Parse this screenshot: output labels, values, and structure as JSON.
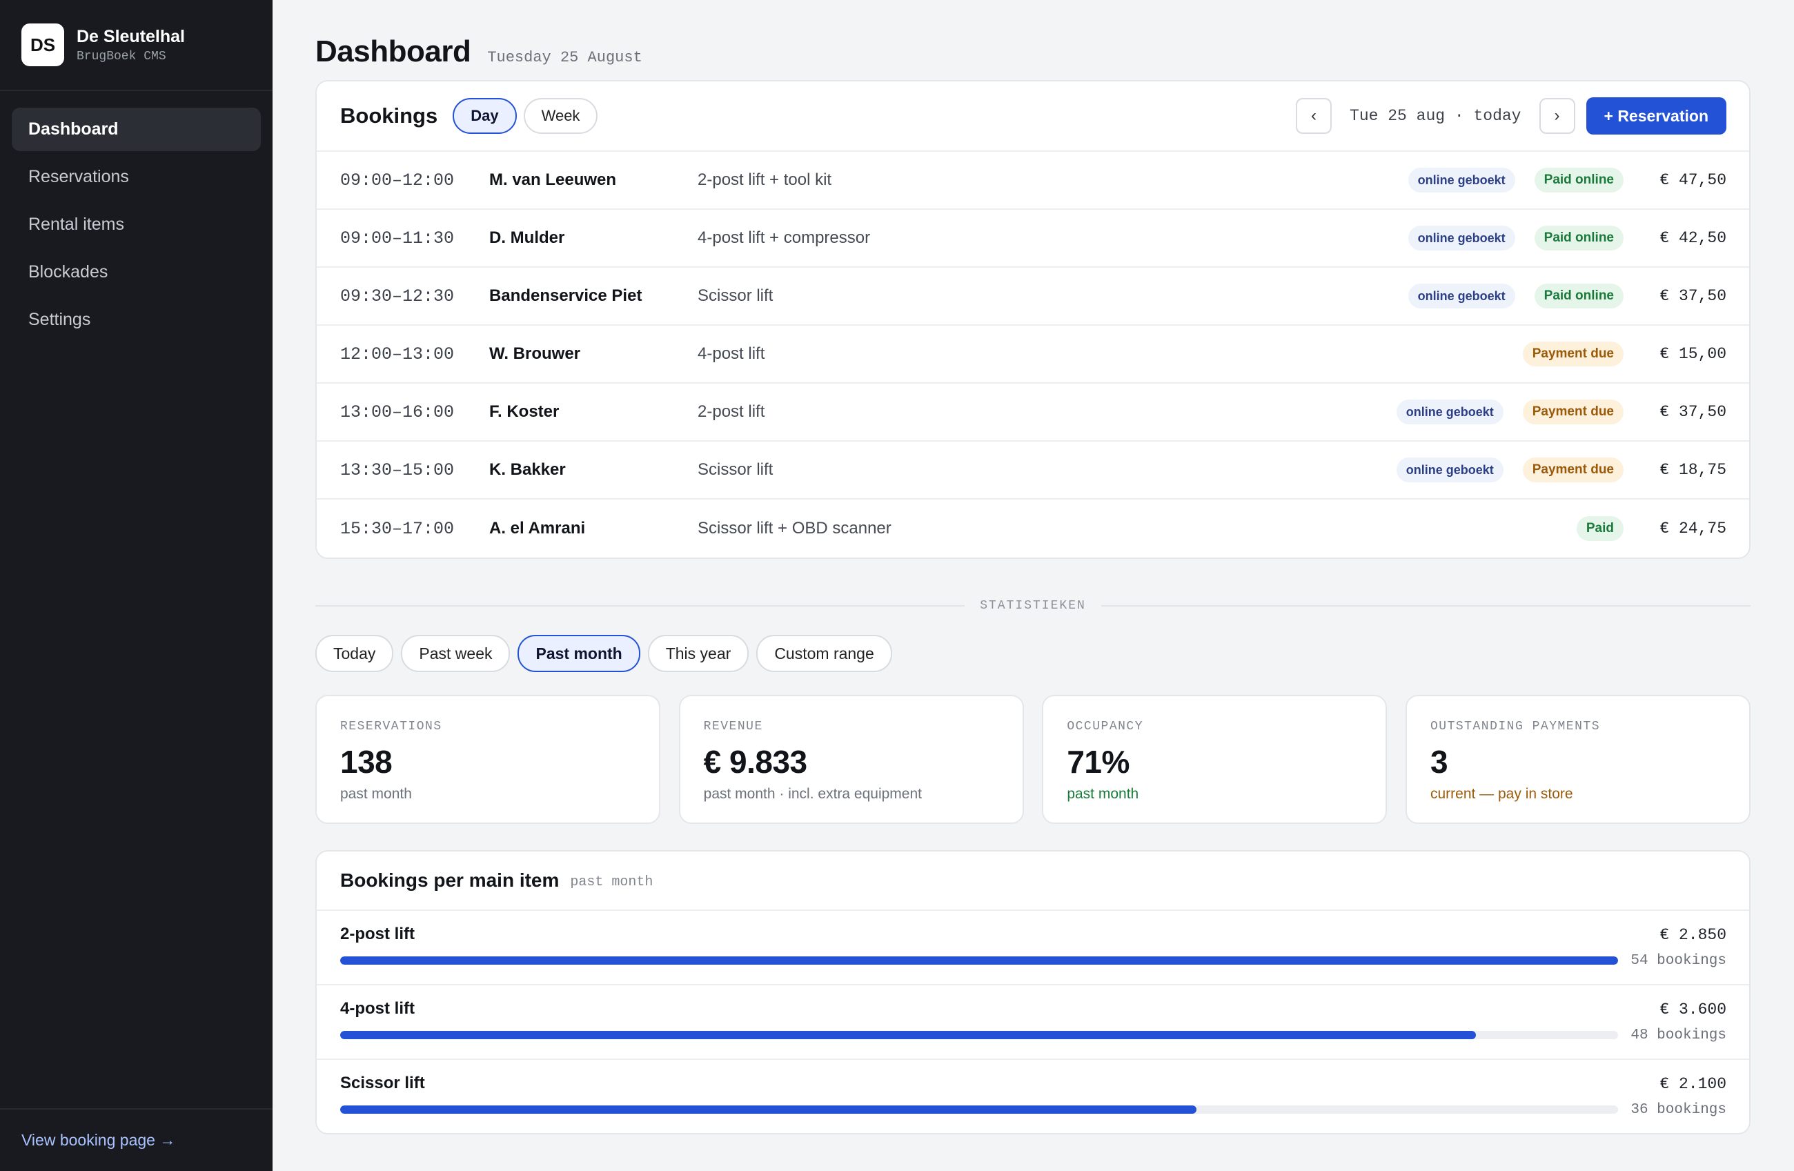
{
  "brand": {
    "initials": "DS",
    "name": "De Sleutelhal",
    "subtitle": "BrugBoek CMS"
  },
  "nav": [
    {
      "label": "Dashboard",
      "active": true
    },
    {
      "label": "Reservations",
      "active": false
    },
    {
      "label": "Rental items",
      "active": false
    },
    {
      "label": "Blockades",
      "active": false
    },
    {
      "label": "Settings",
      "active": false
    }
  ],
  "footer_link": "View booking page →",
  "header": {
    "title": "Dashboard",
    "date": "Tuesday 25 August"
  },
  "bookings": {
    "title": "Bookings",
    "view_tabs": [
      {
        "label": "Day",
        "active": true
      },
      {
        "label": "Week",
        "active": false
      }
    ],
    "prev_label": "‹",
    "next_label": "›",
    "date_label": "Tue 25 aug · today",
    "new_button": "+ Reservation",
    "rows": [
      {
        "time": "09:00–12:00",
        "name": "M. van Leeuwen",
        "item": "2-post lift + tool kit",
        "online": "online geboekt",
        "status": "Paid online",
        "status_type": "paid",
        "amount": "€ 47,50"
      },
      {
        "time": "09:00–11:30",
        "name": "D. Mulder",
        "item": "4-post lift + compressor",
        "online": "online geboekt",
        "status": "Paid online",
        "status_type": "paid",
        "amount": "€ 42,50"
      },
      {
        "time": "09:30–12:30",
        "name": "Bandenservice Piet",
        "item": "Scissor lift",
        "online": "online geboekt",
        "status": "Paid online",
        "status_type": "paid",
        "amount": "€ 37,50"
      },
      {
        "time": "12:00–13:00",
        "name": "W. Brouwer",
        "item": "4-post lift",
        "online": "",
        "status": "Payment due",
        "status_type": "due",
        "amount": "€ 15,00"
      },
      {
        "time": "13:00–16:00",
        "name": "F. Koster",
        "item": "2-post lift",
        "online": "online geboekt",
        "status": "Payment due",
        "status_type": "due",
        "amount": "€ 37,50"
      },
      {
        "time": "13:30–15:00",
        "name": "K. Bakker",
        "item": "Scissor lift",
        "online": "online geboekt",
        "status": "Payment due",
        "status_type": "due",
        "amount": "€ 18,75"
      },
      {
        "time": "15:30–17:00",
        "name": "A. el Amrani",
        "item": "Scissor lift + OBD scanner",
        "online": "",
        "status": "Paid",
        "status_type": "paid",
        "amount": "€ 24,75"
      }
    ]
  },
  "stats_divider": "STATISTIEKEN",
  "ranges": [
    {
      "label": "Today",
      "active": false
    },
    {
      "label": "Past week",
      "active": false
    },
    {
      "label": "Past month",
      "active": true
    },
    {
      "label": "This year",
      "active": false
    },
    {
      "label": "Custom range",
      "active": false
    }
  ],
  "kpis": [
    {
      "label": "RESERVATIONS",
      "value": "138",
      "sub": "past month",
      "tone": ""
    },
    {
      "label": "REVENUE",
      "value": "€ 9.833",
      "sub": "past month · incl. extra equipment",
      "tone": ""
    },
    {
      "label": "OCCUPANCY",
      "value": "71%",
      "sub": "past month",
      "tone": "green"
    },
    {
      "label": "OUTSTANDING PAYMENTS",
      "value": "3",
      "sub": "current — pay in store",
      "tone": "amber"
    }
  ],
  "per_item": {
    "title": "Bookings per main item",
    "subtitle": "past month",
    "rows": [
      {
        "name": "2-post lift",
        "amount": "€ 2.850",
        "count": "54 bookings",
        "fraction": 1.0
      },
      {
        "name": "4-post lift",
        "amount": "€ 3.600",
        "count": "48 bookings",
        "fraction": 0.889
      },
      {
        "name": "Scissor lift",
        "amount": "€ 2.100",
        "count": "36 bookings",
        "fraction": 0.67
      }
    ]
  },
  "colors": {
    "accent": "#2452d6",
    "sidebar": "#181a1f",
    "paid": "#1a7a3a",
    "due": "#9a5a0a"
  }
}
